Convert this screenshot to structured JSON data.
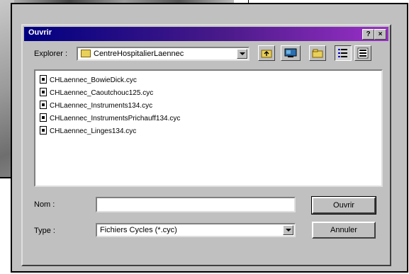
{
  "dialog": {
    "title": "Ouvrir",
    "help_label": "?",
    "close_label": "×"
  },
  "lookin": {
    "label": "Explorer :",
    "value": "CentreHospitalierLaennec"
  },
  "files": [
    "CHLaennec_BowieDick.cyc",
    "CHLaennec_Caoutchouc125.cyc",
    "CHLaennec_Instruments134.cyc",
    "CHLaennec_InstrumentsPrichauff134.cyc",
    "CHLaennec_Linges134.cyc"
  ],
  "filename": {
    "label": "Nom :",
    "value": ""
  },
  "filetype": {
    "label": "Type :",
    "value": "Fichiers Cycles (*.cyc)"
  },
  "buttons": {
    "open": "Ouvrir",
    "cancel": "Annuler"
  },
  "icons": {
    "up_folder": "up-folder-icon",
    "desktop": "desktop-icon",
    "new_folder": "new-folder-icon",
    "list_view": "list-view-icon",
    "details_view": "details-view-icon"
  }
}
